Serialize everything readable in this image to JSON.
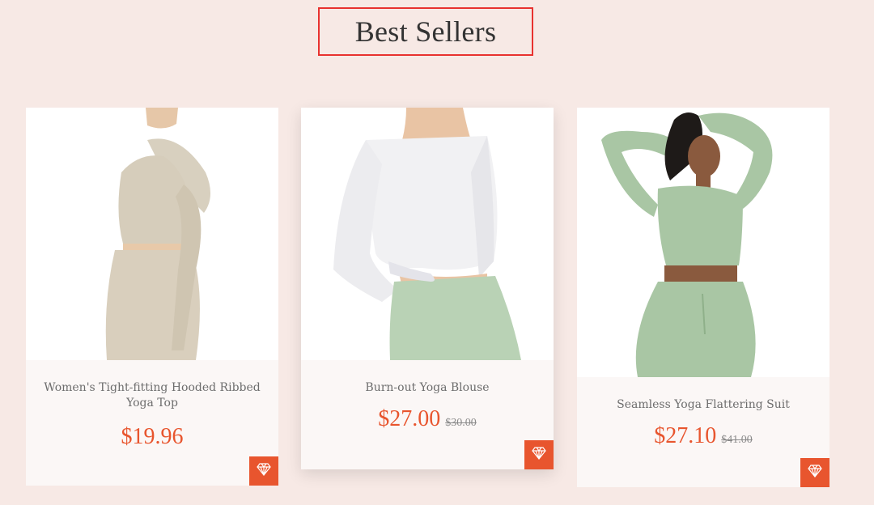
{
  "section": {
    "title": "Best Sellers"
  },
  "products": [
    {
      "name": "Women's Tight-fitting Hooded Ribbed Yoga Top",
      "price": "$19.96",
      "old_price": ""
    },
    {
      "name": "Burn-out Yoga Blouse",
      "price": "$27.00",
      "old_price": "$30.00"
    },
    {
      "name": "Seamless Yoga Flattering Suit",
      "price": "$27.10",
      "old_price": "$41.00"
    }
  ],
  "icons": {
    "wishlist": "diamond-icon"
  },
  "colors": {
    "accent": "#e8552e",
    "title_border": "#e8322f",
    "background": "#f7e9e5"
  }
}
